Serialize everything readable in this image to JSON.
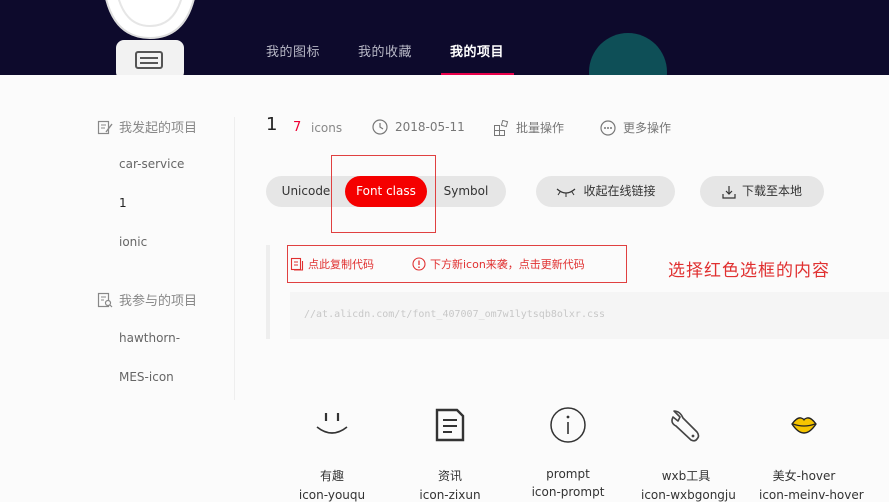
{
  "nav": {
    "items": [
      "我的图标",
      "我的收藏",
      "我的项目"
    ],
    "active": 2
  },
  "sidebar": {
    "initiated_heading": "我发起的项目",
    "initiated_items": [
      "car-service",
      "1",
      "ionic"
    ],
    "current_index": 1,
    "joined_heading": "我参与的项目",
    "joined_items": [
      "hawthorn-",
      "MES-icon"
    ]
  },
  "project": {
    "name": "1",
    "icon_count": "7",
    "icon_count_unit": "icons",
    "date": "2018-05-11",
    "batch_label": "批量操作",
    "more_label": "更多操作"
  },
  "tabs": {
    "unicode": "Unicode",
    "font_class": "Font class",
    "symbol": "Symbol"
  },
  "buttons": {
    "collapse_link": "收起在线链接",
    "download": "下载至本地"
  },
  "code": {
    "copy_label": "点此复制代码",
    "update_label": "下方新icon来袭，点击更新代码",
    "url": "//at.alicdn.com/t/font_407007_om7w1lytsqb8olxr.css"
  },
  "annotation": "选择红色选框的内容",
  "icons": [
    {
      "name": "有趣",
      "code": "icon-youqu",
      "glyph": "smile-icon"
    },
    {
      "name": "资讯",
      "code": "icon-zixun",
      "glyph": "document-icon"
    },
    {
      "name": "prompt",
      "code": "icon-prompt",
      "glyph": "info-circle-icon"
    },
    {
      "name": "wxb工具",
      "code": "icon-wxbgongju",
      "glyph": "wrench-icon"
    },
    {
      "name": "美女-hover",
      "code": "icon-meinv-hover",
      "glyph": "lips-icon"
    }
  ],
  "colors": {
    "topbar": "#0d0a2c",
    "accent": "#f50000",
    "nav_underline": "#e8004a",
    "annotation": "#e03030",
    "lips": "#f5c400"
  }
}
